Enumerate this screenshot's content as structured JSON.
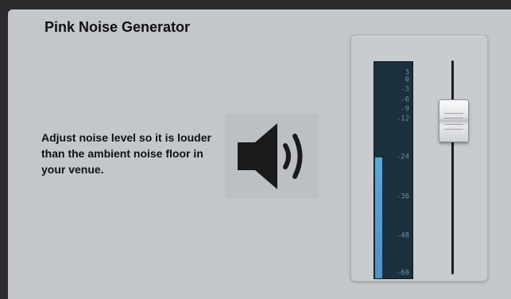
{
  "panel": {
    "title": "Pink Noise Generator",
    "description": "Adjust noise level so it is louder than the ambient noise floor in your venue."
  },
  "speaker": {
    "icon": "speaker-volume-icon"
  },
  "meter": {
    "scale_labels": [
      "3",
      "0",
      "-3",
      "-6",
      "-9",
      "-12",
      "-24",
      "-36",
      "-48",
      "-60"
    ],
    "level_db": -24,
    "fill_color": "#4a94c6"
  },
  "fader": {
    "level_db": -9
  },
  "colors": {
    "panel_bg": "#c3c6cb",
    "meter_bg": "#1c2f3c",
    "meter_label": "#6f8fa3"
  }
}
